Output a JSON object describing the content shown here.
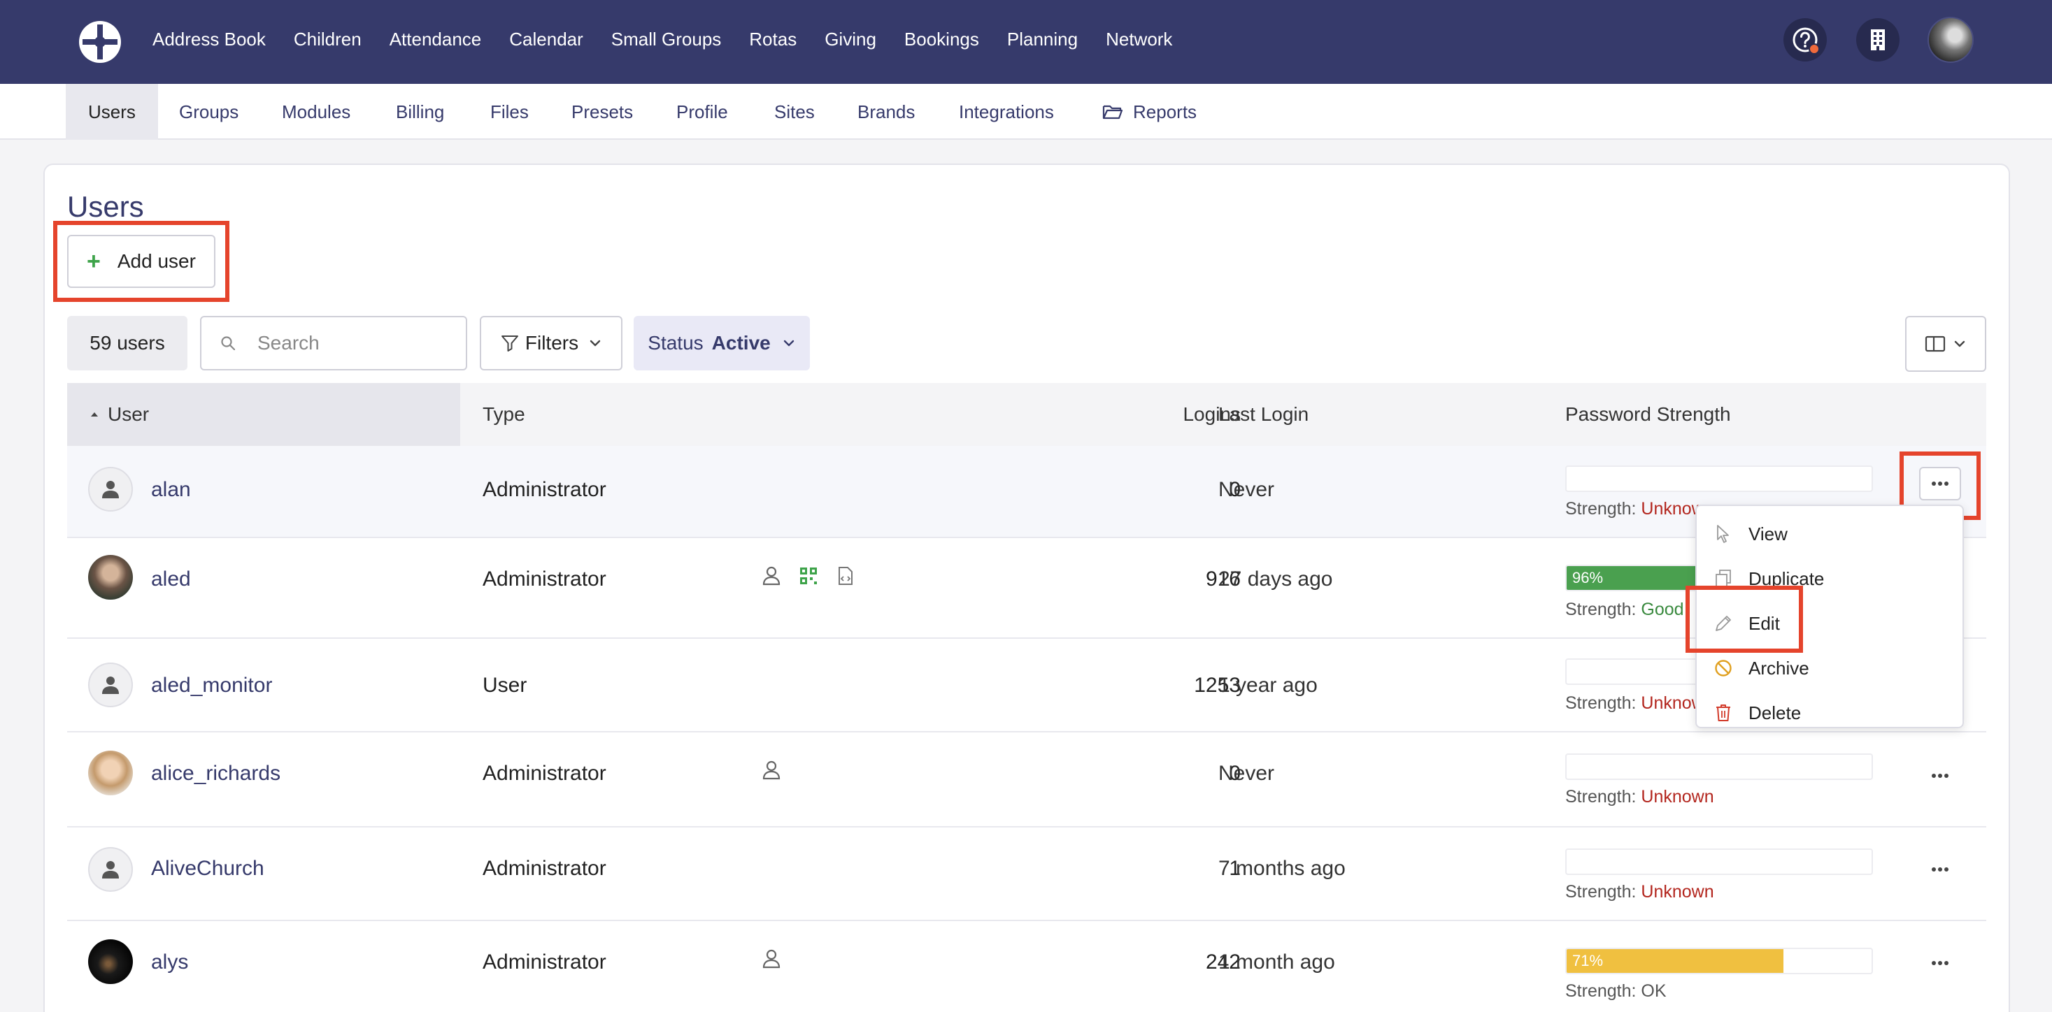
{
  "topnav": {
    "links": [
      "Address Book",
      "Children",
      "Attendance",
      "Calendar",
      "Small Groups",
      "Rotas",
      "Giving",
      "Bookings",
      "Planning",
      "Network"
    ],
    "icons": [
      "help-icon",
      "building-icon",
      "user-avatar"
    ]
  },
  "subnav": {
    "tabs": [
      "Users",
      "Groups",
      "Modules",
      "Billing",
      "Files",
      "Presets",
      "Profile",
      "Sites",
      "Brands",
      "Integrations",
      "Reports"
    ],
    "active": "Users"
  },
  "page": {
    "title": "Users",
    "add_user": "Add user",
    "count": "59 users",
    "search_placeholder": "Search",
    "filters": "Filters",
    "status_label": "Status",
    "status_value": "Active"
  },
  "table": {
    "headers": {
      "user": "User",
      "type": "Type",
      "logins": "Logins",
      "last_login": "Last Login",
      "password": "Password Strength"
    },
    "rows": [
      {
        "user": "alan",
        "type": "Administrator",
        "logins": "0",
        "last_login": "Never",
        "strength_label": "Strength:",
        "strength": "Unknown",
        "strength_color": "#b3261e"
      },
      {
        "user": "aled",
        "type": "Administrator",
        "logins": "916",
        "last_login": "27 days ago",
        "pct": "96%",
        "pct_value": 0.96,
        "bar_color": "#4aa04f",
        "strength_label": "Strength:",
        "strength": "Good",
        "strength_color": "#3a8a3f"
      },
      {
        "user": "aled_monitor",
        "type": "User",
        "logins": "1253",
        "last_login": "1 year ago",
        "strength_label": "Strength:",
        "strength": "Unknown",
        "strength_color": "#b3261e"
      },
      {
        "user": "alice_richards",
        "type": "Administrator",
        "logins": "0",
        "last_login": "Never",
        "strength_label": "Strength:",
        "strength": "Unknown",
        "strength_color": "#b3261e"
      },
      {
        "user": "AliveChurch",
        "type": "Administrator",
        "logins": "1",
        "last_login": "7 months ago",
        "strength_label": "Strength:",
        "strength": "Unknown",
        "strength_color": "#b3261e"
      },
      {
        "user": "alys",
        "type": "Administrator",
        "logins": "242",
        "last_login": "1 month ago",
        "pct": "71%",
        "pct_value": 0.71,
        "bar_color": "#f0c040",
        "strength_label": "Strength:",
        "strength": "OK",
        "strength_color": "#555555"
      }
    ]
  },
  "menu": {
    "items": [
      "View",
      "Duplicate",
      "Edit",
      "Archive",
      "Delete"
    ]
  }
}
